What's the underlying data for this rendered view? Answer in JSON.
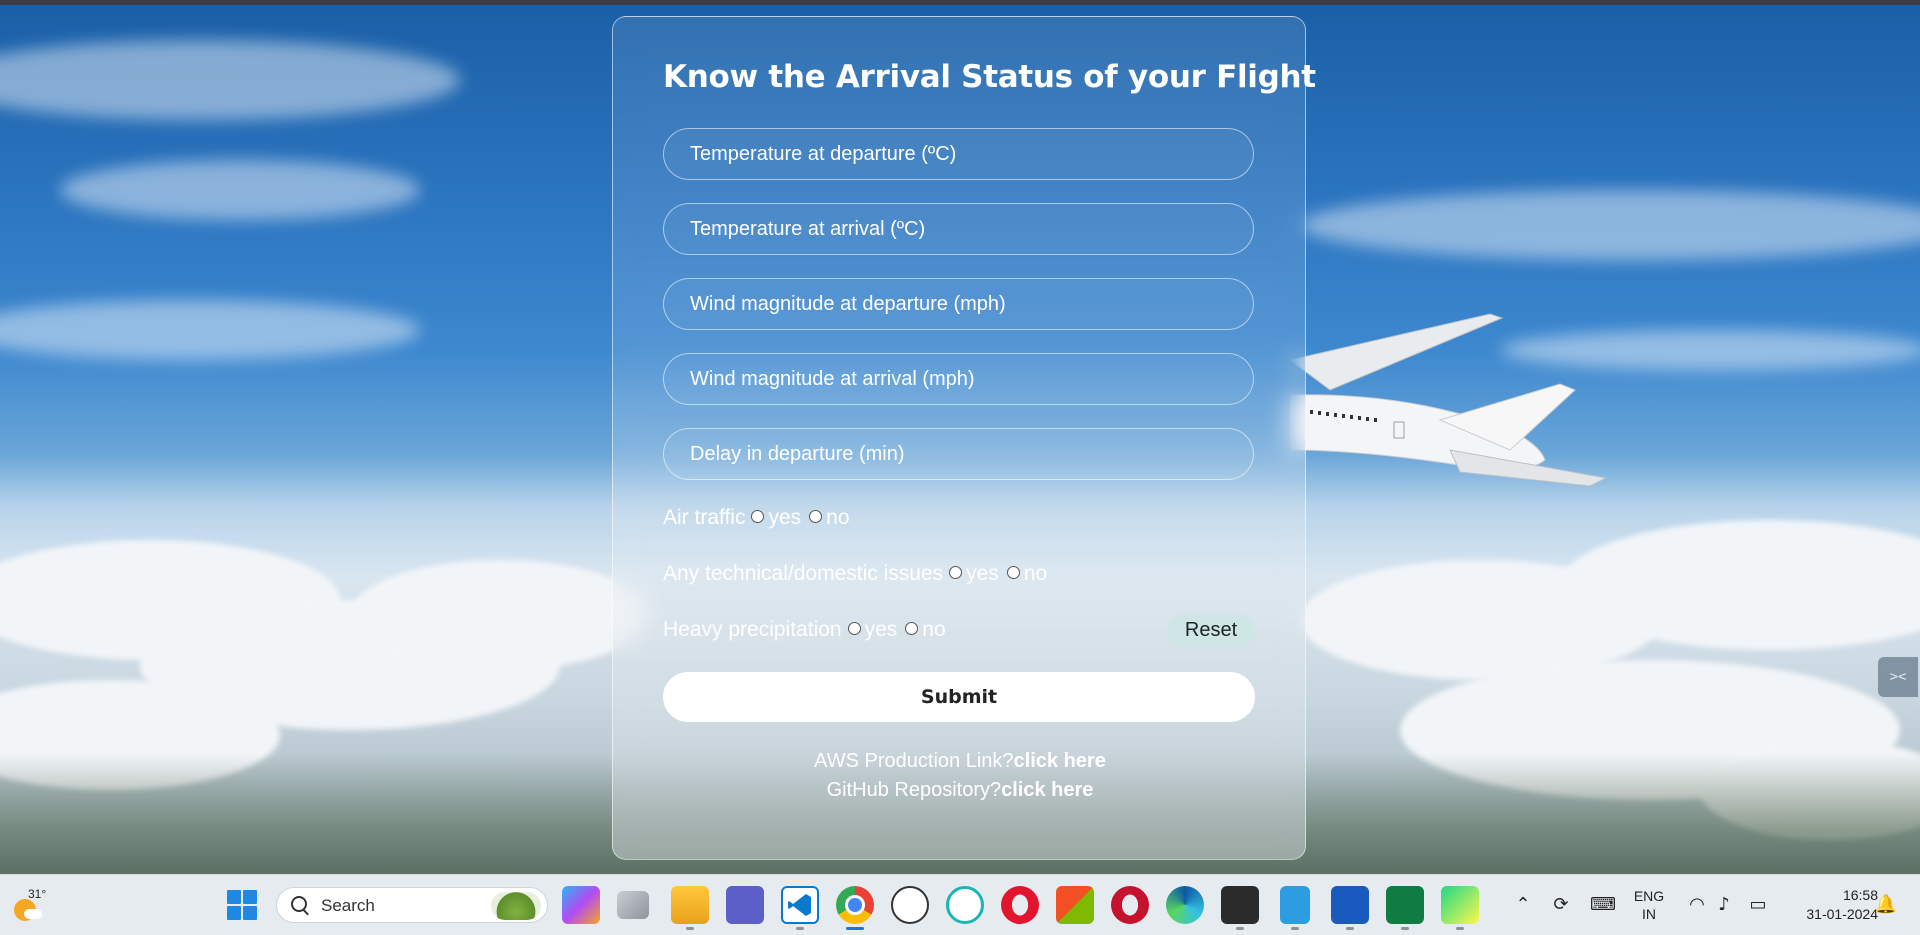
{
  "form": {
    "title": "Know the Arrival Status of your Flight",
    "fields": [
      {
        "placeholder": "Temperature at departure (ºC)",
        "value": ""
      },
      {
        "placeholder": "Temperature at arrival (ºC)",
        "value": ""
      },
      {
        "placeholder": "Wind magnitude at departure (mph)",
        "value": ""
      },
      {
        "placeholder": "Wind magnitude at arrival (mph)",
        "value": ""
      },
      {
        "placeholder": "Delay in departure (min)",
        "value": ""
      }
    ],
    "radio_groups": [
      {
        "label": "Air traffic",
        "yes": "yes",
        "no": "no"
      },
      {
        "label": "Any technical/domestic issues",
        "yes": "yes",
        "no": "no"
      },
      {
        "label": "Heavy precipitation",
        "yes": "yes",
        "no": "no"
      }
    ],
    "reset_label": "Reset",
    "submit_label": "Submit",
    "links": [
      {
        "prefix": "AWS Production Link?",
        "link_text": "click here"
      },
      {
        "prefix": "GitHub Repository?",
        "link_text": "click here"
      }
    ]
  },
  "taskbar": {
    "weather_temp": "31°",
    "search_label": "Search",
    "apps": [
      "copilot-pre-icon",
      "task-view-icon",
      "file-explorer-icon",
      "teams-icon",
      "vscode-icon",
      "chrome-icon",
      "dell-icon",
      "cortana-icon",
      "opera-icon",
      "microsoft-store-icon",
      "opera-gx-icon",
      "edge-icon",
      "terminal-icon",
      "notepad-icon",
      "word-icon",
      "excel-icon",
      "pycharm-icon"
    ],
    "language": "ENG",
    "region": "IN",
    "time": "16:58",
    "date": "31-01-2024"
  },
  "colors": {
    "reset_bg": "#cfe6e6",
    "submit_bg": "#ffffff",
    "taskbar_bg": "#e6ebf0",
    "accent": "#1a73e8"
  }
}
